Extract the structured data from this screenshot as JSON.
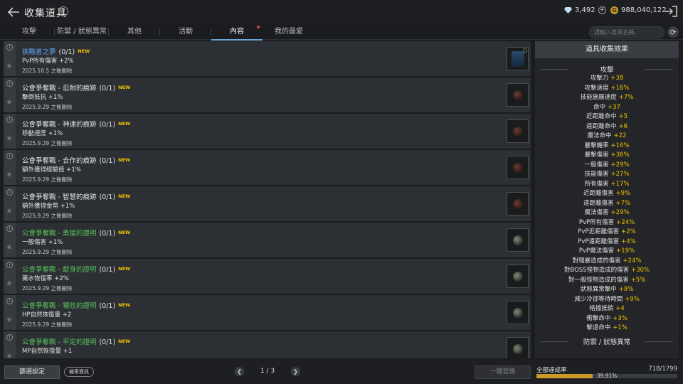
{
  "header": {
    "title": "收集道具",
    "diamonds": "3,492",
    "gold": "988,040,122"
  },
  "tabs": [
    {
      "label": "攻擊"
    },
    {
      "label": "防禦 / 狀態異常"
    },
    {
      "label": "其他"
    },
    {
      "label": "活動"
    },
    {
      "label": "內容"
    },
    {
      "label": "我的最愛"
    }
  ],
  "search": {
    "placeholder": "請輸入道具名稱。"
  },
  "items": [
    {
      "name": "挑戰者之夢",
      "count": "(0/1)",
      "badge": "NEW",
      "effect": "PvP所有傷害 +2%",
      "expire": "2025.10.5 之後刪除",
      "color": "blue"
    },
    {
      "name": "公會爭奪戰 - 忍耐的痕跡",
      "count": "(0/1)",
      "badge": "NEW",
      "effect": "擊倒抵抗 +1%",
      "expire": "2025.9.29 之後刪除",
      "color": "white"
    },
    {
      "name": "公會爭奪戰 - 神速的痕跡",
      "count": "(0/1)",
      "badge": "NEW",
      "effect": "移動速度 +1%",
      "expire": "2025.9.29 之後刪除",
      "color": "white"
    },
    {
      "name": "公會爭奪戰 - 合作的痕跡",
      "count": "(0/1)",
      "badge": "NEW",
      "effect": "額外獲得經驗值 +1%",
      "expire": "2025.9.29 之後刪除",
      "color": "white"
    },
    {
      "name": "公會爭奪戰 - 智慧的痕跡",
      "count": "(0/1)",
      "badge": "NEW",
      "effect": "額外獲得金幣 +1%",
      "expire": "2025.9.29 之後刪除",
      "color": "white"
    },
    {
      "name": "公會爭奪戰 - 勇猛的證明",
      "count": "(0/1)",
      "badge": "NEW",
      "effect": "一般傷害 +1%",
      "expire": "2025.9.29 之後刪除",
      "color": "green"
    },
    {
      "name": "公會爭奪戰 - 獻身的證明",
      "count": "(0/1)",
      "badge": "NEW",
      "effect": "藥水恢復率 +2%",
      "expire": "2025.9.29 之後刪除",
      "color": "green"
    },
    {
      "name": "公會爭奪戰 - 犧牲的證明",
      "count": "(0/1)",
      "badge": "NEW",
      "effect": "HP自然恢復量 +2",
      "expire": "2025.9.29 之後刪除",
      "color": "green"
    },
    {
      "name": "公會爭奪戰 - 平定的證明",
      "count": "(0/1)",
      "badge": "NEW",
      "effect": "MP自然恢復量 +1",
      "expire": "2025.9.29 之後刪除",
      "color": "green"
    }
  ],
  "panel": {
    "title": "道具收集效果",
    "section_attack": "攻擊",
    "attack_stats": [
      {
        "name": "攻擊力",
        "value": "+38"
      },
      {
        "name": "攻擊速度",
        "value": "+16%"
      },
      {
        "name": "技能施展速度",
        "value": "+7%"
      },
      {
        "name": "命中",
        "value": "+37"
      },
      {
        "name": "近距離命中",
        "value": "+5"
      },
      {
        "name": "遠距離命中",
        "value": "+6"
      },
      {
        "name": "魔法命中",
        "value": "+22"
      },
      {
        "name": "暴擊機率",
        "value": "+16%"
      },
      {
        "name": "暴擊傷害",
        "value": "+36%"
      },
      {
        "name": "一般傷害",
        "value": "+29%"
      },
      {
        "name": "技能傷害",
        "value": "+27%"
      },
      {
        "name": "所有傷害",
        "value": "+17%"
      },
      {
        "name": "近距離傷害",
        "value": "+9%"
      },
      {
        "name": "遠距離傷害",
        "value": "+7%"
      },
      {
        "name": "魔法傷害",
        "value": "+29%"
      },
      {
        "name": "PvP所有傷害",
        "value": "+24%"
      },
      {
        "name": "PvP近距離傷害",
        "value": "+2%"
      },
      {
        "name": "PvP遠距離傷害",
        "value": "+4%"
      },
      {
        "name": "PvP魔法傷害",
        "value": "+19%"
      },
      {
        "name": "對殘暴造成的傷害",
        "value": "+24%"
      },
      {
        "name": "對BOSS怪物造成的傷害",
        "value": "+30%"
      },
      {
        "name": "對一般怪物造成的傷害",
        "value": "+5%"
      },
      {
        "name": "狀態異常擊中",
        "value": "+9%"
      },
      {
        "name": "減少冷卻等待時間",
        "value": "+9%"
      },
      {
        "name": "格擋抵銷",
        "value": "+4"
      },
      {
        "name": "衝擊命中",
        "value": "+3%"
      },
      {
        "name": "擊退命中",
        "value": "+1%"
      }
    ],
    "section_defense": "防禦 / 狀態異常"
  },
  "footer": {
    "filter": "篩選設定",
    "probability": "機率資訊",
    "page": "1 / 3",
    "register": "一鍵登錄",
    "progress_label": "全部達成率",
    "progress_count": "718/1799",
    "progress_percent": "39.91%",
    "progress_fraction": 0.3991
  },
  "colors": {
    "accent_gold": "#f0c400",
    "name_blue": "#5fa4ee",
    "name_green": "#58c05a",
    "progress_fill": "#c99a2a"
  }
}
